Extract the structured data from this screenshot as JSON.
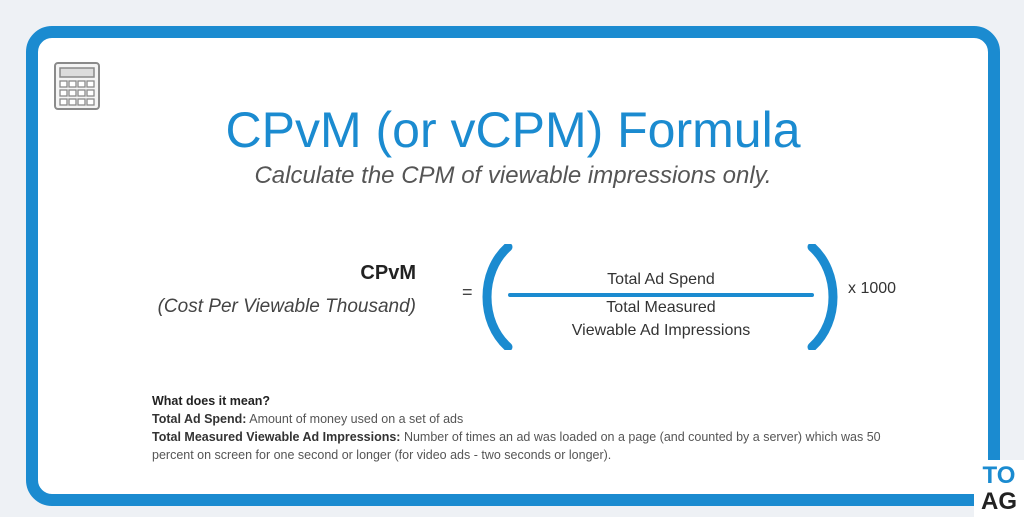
{
  "title": "CPvM (or vCPM) Formula",
  "subtitle": "Calculate the CPM of viewable impressions only.",
  "formula": {
    "lhs_label": "CPvM",
    "lhs_description": "(Cost Per Viewable Thousand)",
    "equals": "=",
    "numerator": "Total Ad Spend",
    "denominator_line1": "Total Measured",
    "denominator_line2": "Viewable Ad Impressions",
    "multiplier": "x 1000"
  },
  "meaning": {
    "heading": "What does it mean?",
    "term1": "Total Ad Spend:",
    "def1": "Amount of money used on a set of ads",
    "term2": "Total Measured Viewable Ad Impressions:",
    "def2": "Number of times an ad was loaded on a page (and counted by a server) which was 50 percent on screen for one second or longer (for video ads - two seconds or longer)."
  },
  "logo": {
    "line1": "TO",
    "line2": "AG"
  },
  "colors": {
    "accent": "#1b8bd0",
    "text_dark": "#222222",
    "text_muted": "#555555"
  },
  "icons": {
    "corner": "calculator-icon"
  }
}
